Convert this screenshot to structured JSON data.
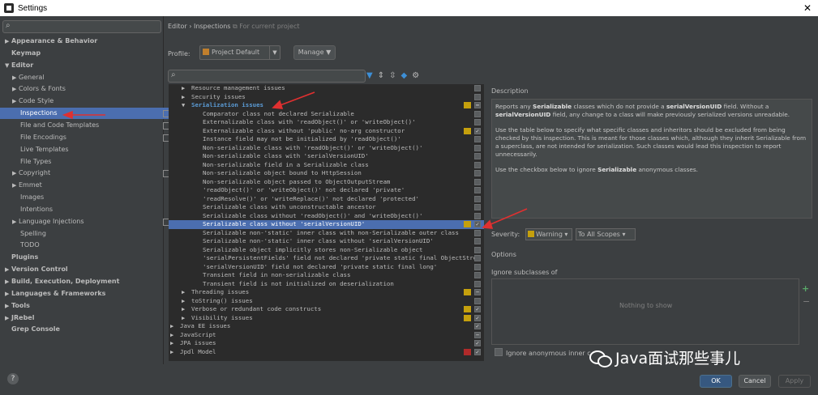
{
  "window": {
    "title": "Settings",
    "close_glyph": "✕"
  },
  "sidebar": {
    "search_placeholder": "",
    "items": [
      {
        "label": "Appearance & Behavior",
        "arrow": "▶",
        "bold": true
      },
      {
        "label": "Keymap",
        "arrow": "",
        "bold": true
      },
      {
        "label": "Editor",
        "arrow": "▼",
        "bold": true
      },
      {
        "label": "General",
        "arrow": "▶"
      },
      {
        "label": "Colors & Fonts",
        "arrow": "▶"
      },
      {
        "label": "Code Style",
        "arrow": "▶"
      },
      {
        "label": "Inspections",
        "arrow": "",
        "selected": true
      },
      {
        "label": "File and Code Templates",
        "arrow": ""
      },
      {
        "label": "File Encodings",
        "arrow": ""
      },
      {
        "label": "Live Templates",
        "arrow": ""
      },
      {
        "label": "File Types",
        "arrow": ""
      },
      {
        "label": "Copyright",
        "arrow": "▶"
      },
      {
        "label": "Emmet",
        "arrow": "▶"
      },
      {
        "label": "Images",
        "arrow": ""
      },
      {
        "label": "Intentions",
        "arrow": ""
      },
      {
        "label": "Language Injections",
        "arrow": "▶"
      },
      {
        "label": "Spelling",
        "arrow": ""
      },
      {
        "label": "TODO",
        "arrow": ""
      },
      {
        "label": "Plugins",
        "arrow": "",
        "bold": true
      },
      {
        "label": "Version Control",
        "arrow": "▶",
        "bold": true
      },
      {
        "label": "Build, Execution, Deployment",
        "arrow": "▶",
        "bold": true
      },
      {
        "label": "Languages & Frameworks",
        "arrow": "▶",
        "bold": true
      },
      {
        "label": "Tools",
        "arrow": "▶",
        "bold": true
      },
      {
        "label": "JRebel",
        "arrow": "▶",
        "bold": true
      },
      {
        "label": "Grep Console",
        "arrow": "",
        "bold": true
      }
    ]
  },
  "header": {
    "breadcrumb": "Editor › Inspections",
    "project_note": "For current project",
    "profile_label": "Profile:",
    "profile_value": "Project Default",
    "manage_label": "Manage ▼"
  },
  "inspections": [
    {
      "label": "Resource management issues",
      "level": 1,
      "arrow": "▶",
      "sev": "",
      "check": ""
    },
    {
      "label": "Security issues",
      "level": 1,
      "arrow": "▶",
      "sev": "",
      "check": ""
    },
    {
      "label": "Serialization issues",
      "level": 1,
      "arrow": "▼",
      "sev": "#c5a00d",
      "check": "−",
      "highlight": true
    },
    {
      "label": "Comparator class not declared Serializable",
      "level": 2,
      "sev": "",
      "check": ""
    },
    {
      "label": "Externalizable class with 'readObject()' or 'writeObject()'",
      "level": 2,
      "sev": "",
      "check": ""
    },
    {
      "label": "Externalizable class without 'public' no-arg constructor",
      "level": 2,
      "sev": "#c5a00d",
      "check": "✓"
    },
    {
      "label": "Instance field may not be initialized by 'readObject()'",
      "level": 2,
      "sev": "",
      "check": ""
    },
    {
      "label": "Non-serializable class with 'readObject()' or 'writeObject()'",
      "level": 2,
      "sev": "",
      "check": ""
    },
    {
      "label": "Non-serializable class with 'serialVersionUID'",
      "level": 2,
      "sev": "",
      "check": ""
    },
    {
      "label": "Non-serializable field in a Serializable class",
      "level": 2,
      "sev": "",
      "check": ""
    },
    {
      "label": "Non-serializable object bound to HttpSession",
      "level": 2,
      "sev": "",
      "check": ""
    },
    {
      "label": "Non-serializable object passed to ObjectOutputStream",
      "level": 2,
      "sev": "",
      "check": ""
    },
    {
      "label": "'readObject()' or 'writeObject()' not declared 'private'",
      "level": 2,
      "sev": "",
      "check": ""
    },
    {
      "label": "'readResolve()' or 'writeReplace()' not declared 'protected'",
      "level": 2,
      "sev": "",
      "check": ""
    },
    {
      "label": "Serializable class with unconstructable ancestor",
      "level": 2,
      "sev": "",
      "check": ""
    },
    {
      "label": "Serializable class without 'readObject()' and 'writeObject()'",
      "level": 2,
      "sev": "",
      "check": ""
    },
    {
      "label": "Serializable class without 'serialVersionUID'",
      "level": 2,
      "sev": "#c5a00d",
      "check": "✓",
      "selected": true
    },
    {
      "label": "Serializable non-'static' inner class with non-Serializable outer class",
      "level": 2,
      "sev": "",
      "check": ""
    },
    {
      "label": "Serializable non-'static' inner class without 'serialVersionUID'",
      "level": 2,
      "sev": "",
      "check": ""
    },
    {
      "label": "Serializable object implicitly stores non-Serializable object",
      "level": 2,
      "sev": "",
      "check": ""
    },
    {
      "label": "'serialPersistentFields' field not declared 'private static final ObjectStre",
      "level": 2,
      "sev": "",
      "check": ""
    },
    {
      "label": "'serialVersionUID' field not declared 'private static final long'",
      "level": 2,
      "sev": "",
      "check": ""
    },
    {
      "label": "Transient field in non-serializable class",
      "level": 2,
      "sev": "",
      "check": ""
    },
    {
      "label": "Transient field is not initialized on deserialization",
      "level": 2,
      "sev": "",
      "check": ""
    },
    {
      "label": "Threading issues",
      "level": 1,
      "arrow": "▶",
      "sev": "#c5a00d",
      "check": "−"
    },
    {
      "label": "toString() issues",
      "level": 1,
      "arrow": "▶",
      "sev": "",
      "check": ""
    },
    {
      "label": "Verbose or redundant code constructs",
      "level": 1,
      "arrow": "▶",
      "sev": "#c5a00d",
      "check": "✓"
    },
    {
      "label": "Visibility issues",
      "level": 1,
      "arrow": "▶",
      "sev": "#c5a00d",
      "check": "✓"
    },
    {
      "label": "Java EE issues",
      "level": 0,
      "arrow": "▶",
      "sev": "",
      "check": "✓"
    },
    {
      "label": "JavaScript",
      "level": 0,
      "arrow": "▶",
      "sev": "",
      "check": "−"
    },
    {
      "label": "JPA issues",
      "level": 0,
      "arrow": "▶",
      "sev": "",
      "check": "✓"
    },
    {
      "label": "Jpdl Model",
      "level": 0,
      "arrow": "▶",
      "sev": "#b02a2a",
      "check": "✓"
    }
  ],
  "description": {
    "title": "Description",
    "p1_parts": [
      "Reports any ",
      "Serializable",
      " classes which do not provide a ",
      "serialVersionUID",
      " field. Without a ",
      "serialVersionUID",
      " field, any change to a class will make previously serialized versions unreadable."
    ],
    "p2": "Use the table below to specify what specific classes and inheritors should be excluded from being checked by this inspection. This is meant for those classes which, although they inherit Serializable from a superclass, are not intended for serialization. Such classes would lead this inspection to report unnecessarily.",
    "p3_parts": [
      "Use the checkbox below to ignore ",
      "Serializable",
      " anonymous classes."
    ]
  },
  "severity": {
    "label": "Severity:",
    "value": "Warning",
    "scope": "To All Scopes"
  },
  "options": {
    "label": "Options",
    "ignore_subclasses": "Ignore subclasses of",
    "empty_text": "Nothing to show",
    "ignore_anonymous": "Ignore anonymous inner c"
  },
  "watermark": "Java面试那些事儿",
  "buttons": {
    "ok": "OK",
    "cancel": "Cancel",
    "apply": "Apply",
    "help": "?"
  }
}
